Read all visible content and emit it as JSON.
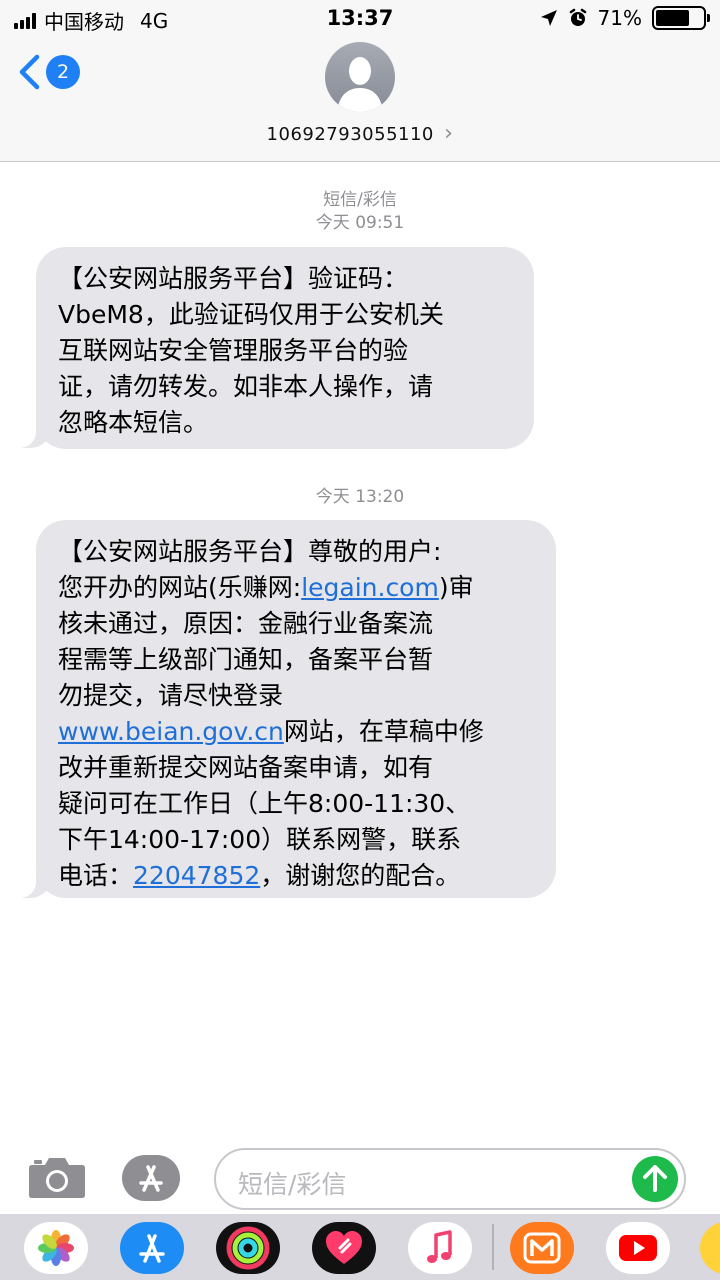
{
  "status_bar": {
    "carrier": "中国移动",
    "network": "4G",
    "time": "13:37",
    "battery": "71%",
    "battery_level": 0.71,
    "icons": [
      "signal-icon",
      "location-arrow-icon",
      "alarm-clock-icon",
      "battery-icon"
    ]
  },
  "nav": {
    "back_icon": "chevron-left-icon",
    "unread_badge": "2",
    "contact_number": "10692793055110",
    "contact_chevron": "›"
  },
  "messages": {
    "service_label": "短信/彩信",
    "timestamp_1": "今天 09:51",
    "msg_1_lines": [
      "【公安网站服务平台】验证码：",
      "VbeM8，此验证码仅用于公安机关",
      "互联网站安全管理服务平台的验",
      "证，请勿转发。如非本人操作，请",
      "忽略本短信。"
    ],
    "timestamp_2": "今天 13:20",
    "msg_2": {
      "l1": "【公安网站服务平台】尊敬的用户:",
      "l2_a": "您开办的网站(乐赚网:",
      "l2_link": "legain.com",
      "l2_b": ")审",
      "l3": "核未通过，原因：金融行业备案流",
      "l4": "程需等上级部门通知，备案平台暂",
      "l5": "勿提交，请尽快登录",
      "l6_link": "www.beian.gov.cn",
      "l6_b": "网站，在草稿中修",
      "l7": "改并重新提交网站备案申请，如有",
      "l8": "疑问可在工作日（上午8:00-11:30、",
      "l9": "下午14:00-17:00）联系网警，联系",
      "l10_a": "电话：",
      "l10_link": "22047852",
      "l10_b": "，谢谢您的配合。"
    }
  },
  "compose": {
    "placeholder": "短信/彩信",
    "camera_icon": "camera-icon",
    "apps_icon": "app-store-icon",
    "send_icon": "send-arrow-icon"
  },
  "app_drawer": {
    "apps": [
      "photos-app-icon",
      "app-store-app-icon",
      "activity-app-icon",
      "digital-touch-app-icon",
      "music-app-icon",
      "mango-tv-app-icon",
      "youtube-app-icon",
      "sticker-app-icon"
    ]
  },
  "colors": {
    "accent": "#1f7ff5",
    "bubble": "#e5e5ea",
    "link": "#1e70d8",
    "send": "#1fba4c"
  }
}
